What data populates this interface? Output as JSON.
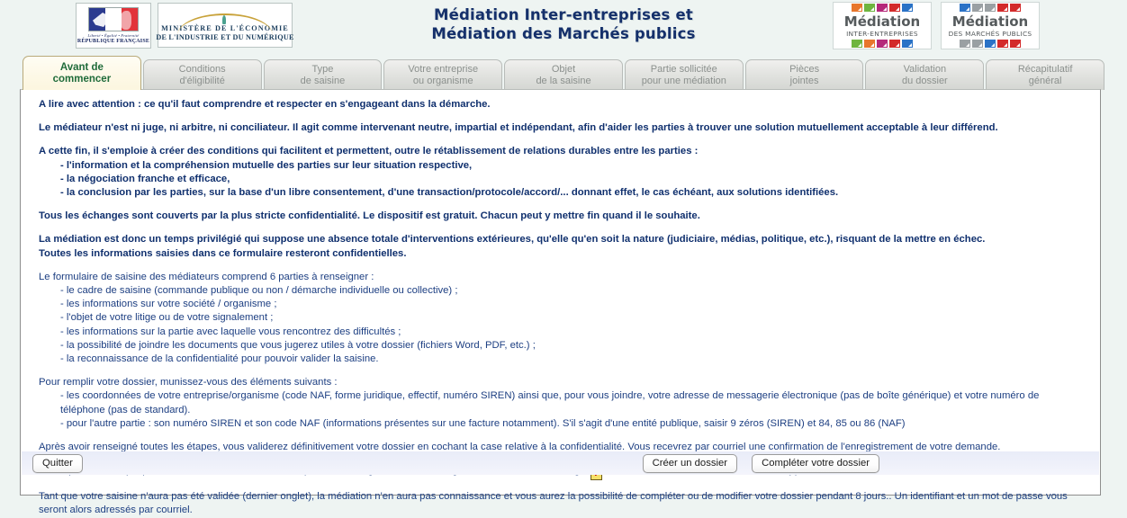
{
  "header": {
    "title_line1": "Médiation Inter-entreprises et",
    "title_line2": "Médiation des Marchés publics",
    "republic_logo": {
      "devise": "Liberté • Égalité • Fraternité",
      "name": "RÉPUBLIQUE FRANÇAISE"
    },
    "ministry_logo": {
      "line1": "MINISTÈRE DE L'ÉCONOMIE",
      "line2": "DE L'INDUSTRIE ET DU NUMÉRIQUE"
    },
    "mediation_inter_logo": {
      "word": "Médiation",
      "sub": "INTER-ENTREPRISES"
    },
    "mediation_public_logo": {
      "word": "Médiation",
      "sub": "DES MARCHÉS PUBLICS"
    },
    "logo_square_colors": [
      "#e8762c",
      "#6fb53f",
      "#b5287a",
      "#d32a2a",
      "#2a72c6"
    ],
    "logo_square_colors_grey": [
      "#2a72c6",
      "#9aa0a3",
      "#9aa0a3",
      "#d32a2a",
      "#d32a2a"
    ]
  },
  "tabs": [
    {
      "line1": "Avant de",
      "line2": "commencer",
      "active": true
    },
    {
      "line1": "Conditions",
      "line2": "d'éligibilité",
      "active": false
    },
    {
      "line1": "Type",
      "line2": "de saisine",
      "active": false
    },
    {
      "line1": "Votre entreprise",
      "line2": "ou organisme",
      "active": false
    },
    {
      "line1": "Objet",
      "line2": "de la saisine",
      "active": false
    },
    {
      "line1": "Partie sollicitée",
      "line2": "pour une médiation",
      "active": false
    },
    {
      "line1": "Pièces",
      "line2": "jointes",
      "active": false
    },
    {
      "line1": "Validation",
      "line2": "du dossier",
      "active": false
    },
    {
      "line1": "Récapitulatif",
      "line2": "général",
      "active": false
    }
  ],
  "content": {
    "p1": "A lire avec attention : ce qu'il faut comprendre et respecter en s'engageant dans la démarche.",
    "p2": "Le médiateur n'est ni juge, ni arbitre, ni conciliateur. Il agit comme intervenant neutre, impartial et indépendant, afin d'aider les parties à trouver une solution mutuellement acceptable à leur différend.",
    "p3": "A cette fin, il s'emploie à créer des conditions qui facilitent et permettent, outre le rétablissement de relations durables entre les parties :",
    "p3_items": [
      "- l'information et la compréhension mutuelle des parties sur leur situation respective,",
      "- la négociation franche et efficace,",
      "- la conclusion par les parties, sur la base d'un libre consentement, d'une transaction/protocole/accord/... donnant effet, le cas échéant, aux solutions identifiées."
    ],
    "p4": "Tous les échanges sont couverts par la plus stricte confidentialité. Le dispositif est gratuit. Chacun peut y mettre fin quand il le souhaite.",
    "p5_line1": "La médiation est donc un temps privilégié qui suppose une absence totale d'interventions extérieures, qu'elle qu'en soit la nature (judiciaire, médias, politique, etc.), risquant de la mettre en échec.",
    "p5_line2": "Toutes les informations saisies dans ce formulaire resteront confidentielles.",
    "p6": "Le formulaire de saisine des médiateurs comprend 6 parties à renseigner :",
    "p6_items": [
      "- le cadre de saisine (commande publique ou non / démarche individuelle ou collective) ;",
      "- les informations sur votre société / organisme ;",
      "- l'objet de votre litige ou de votre signalement ;",
      "- les informations sur la partie avec laquelle vous rencontrez des difficultés ;",
      "- la possibilité de joindre les documents que vous jugerez utiles à votre dossier (fichiers Word, PDF, etc.) ;",
      "- la reconnaissance de la confidentialité pour pouvoir valider la saisine."
    ],
    "p7": "Pour remplir votre dossier, munissez-vous des éléments suivants :",
    "p7_item1": "- les coordonnées de votre entreprise/organisme (code NAF, forme juridique, effectif, numéro SIREN) ainsi que, pour vous joindre, votre adresse de messagerie électronique (pas de boîte générique) et votre numéro de téléphone (pas de standard).",
    "p7_item2": "- pour l'autre partie : son numéro SIREN et son code NAF (informations présentes sur une facture notamment). S'il s'agit d'une entité publique, saisir 9 zéros (SIREN) et 84, 85 ou 86 (NAF)",
    "p8": "Après avoir renseigné toutes les étapes, vous validerez définitivement votre dossier en cochant la case relative à la confidentialité. Vous recevrez par courriel une confirmation de l'enregistrement de votre demande.",
    "p9_asterisk": "*",
    "p9_before_icon": "Lorsqu'un astérisque précède une zone de texte, le champ doit être obligatoirement renseigné. Le survol de cette image",
    "p9_icon_glyph": "?",
    "p9_after_icon": "affichera une information contextuelle supplémentaire.",
    "p10": "Tant que votre saisine n'aura pas été validée (dernier onglet), la médiation n'en aura pas connaissance et vous aurez la possibilité de compléter ou de modifier votre dossier pendant 8 jours.. Un identifiant et un mot de passe vous seront alors adressés par courriel."
  },
  "buttons": {
    "quit": "Quitter",
    "create": "Créer un dossier",
    "complete": "Compléter votre dossier"
  }
}
